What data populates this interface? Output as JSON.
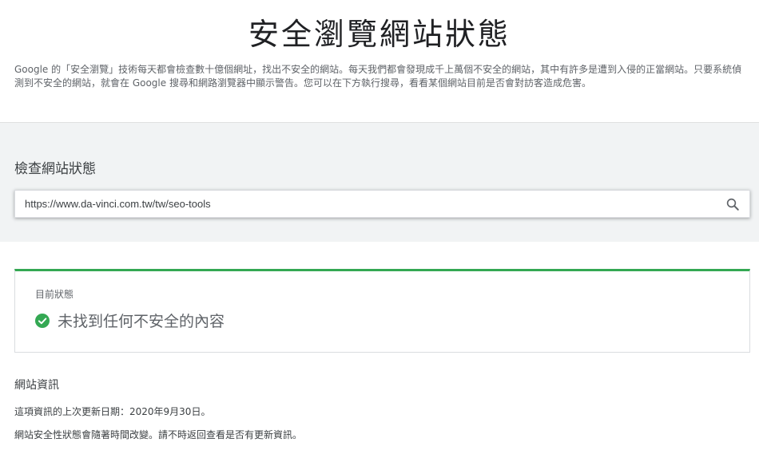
{
  "header": {
    "title": "安全瀏覽網站狀態",
    "intro": "Google 的「安全瀏覽」技術每天都會檢查數十億個網址，找出不安全的網站。每天我們都會發現成千上萬個不安全的網站，其中有許多是遭到入侵的正當網站。只要系統偵測到不安全的網站，就會在 Google 搜尋和網路瀏覽器中顯示警告。您可以在下方執行搜尋，看看某個網站目前是否會對訪客造成危害。"
  },
  "search": {
    "heading": "檢查網站狀態",
    "value": "https://www.da-vinci.com.tw/tw/seo-tools",
    "icon": "search-icon"
  },
  "status": {
    "label": "目前狀態",
    "text": "未找到任何不安全的內容",
    "icon": "check-circle-icon",
    "accent_color": "#34a853"
  },
  "site_info": {
    "heading": "網站資訊",
    "updated": "這項資訊的上次更新日期：2020年9月30日。",
    "note": "網站安全性狀態會隨著時間改變。請不時返回查看是否有更新資訊。"
  }
}
